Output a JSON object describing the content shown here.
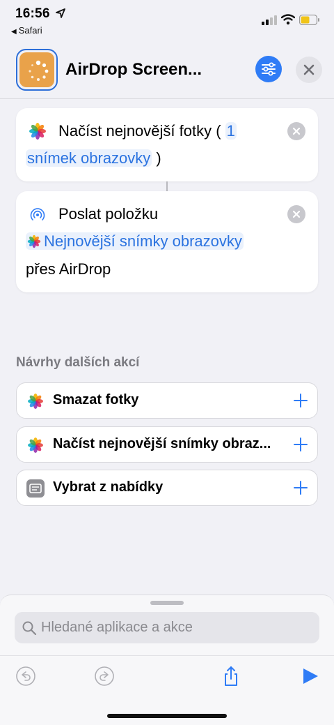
{
  "status_bar": {
    "time": "16:56",
    "back_app": "Safari"
  },
  "header": {
    "title": "AirDrop Screen..."
  },
  "actions": [
    {
      "line1_text": "Načíst nejnovější fotky (",
      "line1_token": "1",
      "line2_token": "snímek obrazovky",
      "line2_text": ")"
    },
    {
      "line1_text": "Poslat položku",
      "line2_token": "Nejnovější snímky obrazovky",
      "line3_text": "přes AirDrop"
    }
  ],
  "suggestions": {
    "heading": "Návrhy dalších akcí",
    "items": [
      {
        "label": "Smazat fotky",
        "icon": "photos-icon"
      },
      {
        "label": "Načíst nejnovější snímky obraz...",
        "icon": "photos-icon"
      },
      {
        "label": "Vybrat z nabídky",
        "icon": "menu-icon"
      }
    ]
  },
  "search": {
    "placeholder": "Hledané aplikace a akce"
  },
  "colors": {
    "accent": "#2f7cf6",
    "token_text": "#2b73e0",
    "app_icon": "#e9a24a"
  }
}
